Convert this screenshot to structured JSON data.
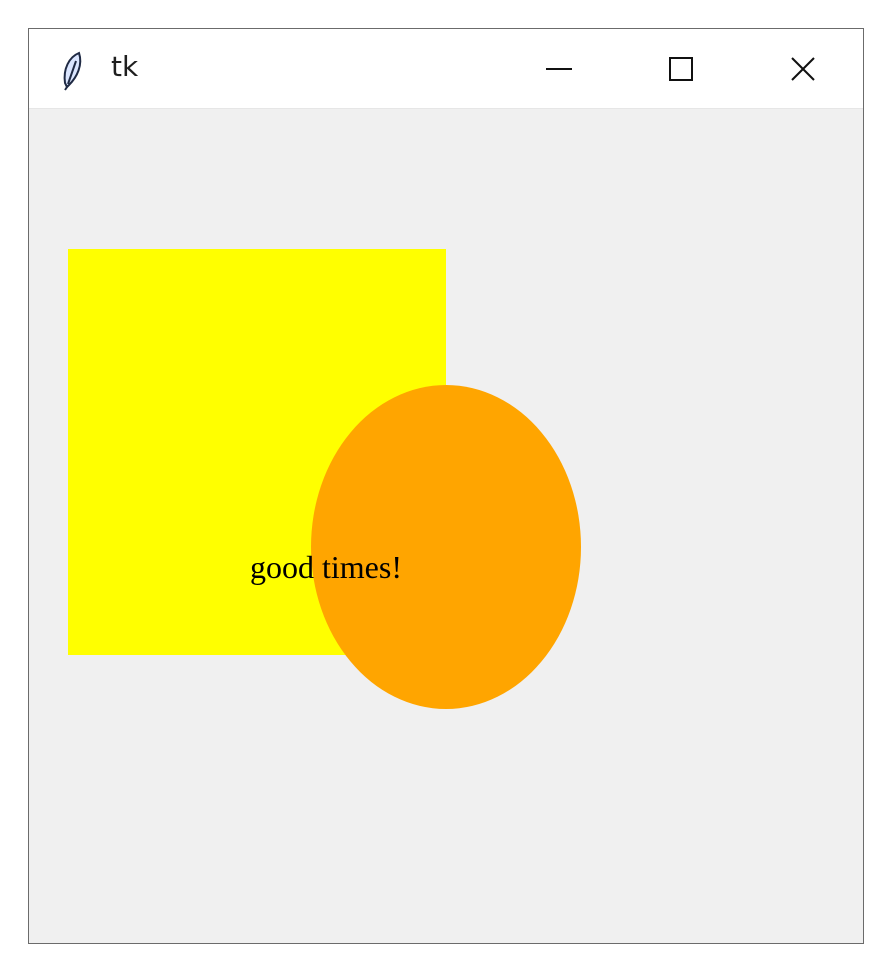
{
  "window": {
    "title": "tk",
    "icons": {
      "app": "feather-icon",
      "minimize": "minimize-icon",
      "maximize": "maximize-icon",
      "close": "close-icon"
    }
  },
  "canvas": {
    "text": "good times!",
    "colors": {
      "background": "#f0f0f0",
      "rectangle": "#ffff00",
      "ellipse": "#ffa500",
      "text": "#000000"
    }
  }
}
